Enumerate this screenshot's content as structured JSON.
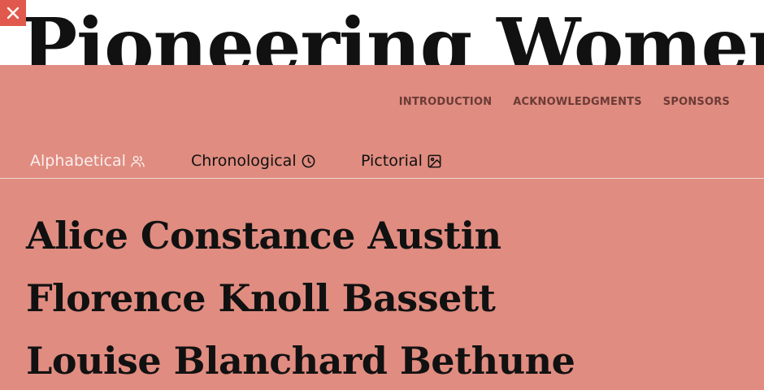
{
  "site": {
    "title": "Pioneering Women"
  },
  "icons": {
    "close": "close-icon",
    "alphabetical": "users-icon",
    "chronological": "clock-icon",
    "pictorial": "image-icon"
  },
  "colors": {
    "panel": "#e08c80",
    "close_button": "#e0594c",
    "nav_text": "#6b3b36",
    "active_tab": "#fbeeee"
  },
  "nav": {
    "items": [
      "INTRODUCTION",
      "ACKNOWLEDGMENTS",
      "SPONSORS"
    ]
  },
  "tabs": [
    {
      "label": "Alphabetical",
      "active": true
    },
    {
      "label": "Chronological",
      "active": false
    },
    {
      "label": "Pictorial",
      "active": false
    }
  ],
  "names": [
    "Alice Constance Austin",
    "Florence Knoll Bassett",
    "Louise Blanchard Bethune"
  ]
}
